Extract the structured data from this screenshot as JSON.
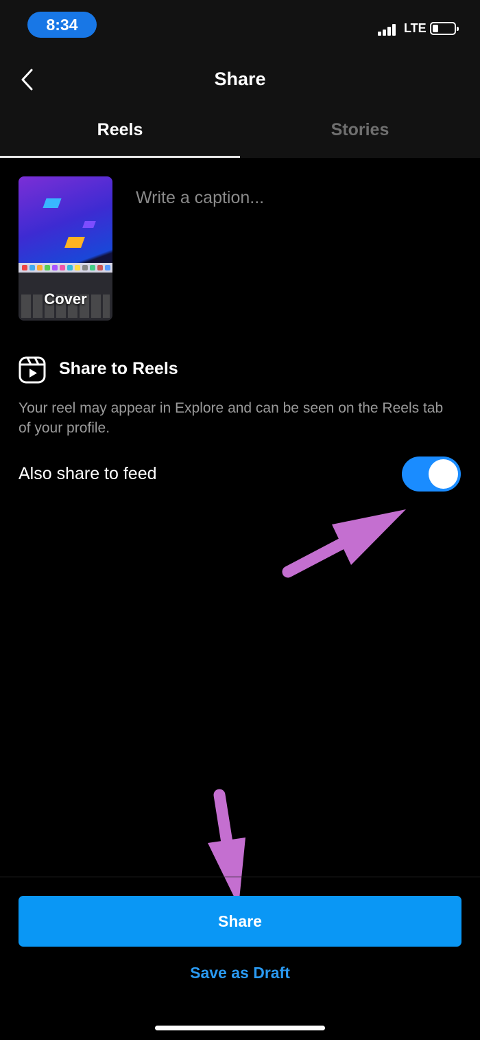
{
  "status_bar": {
    "time": "8:34",
    "network": "LTE"
  },
  "header": {
    "title": "Share",
    "back_icon": "chevron-left-icon"
  },
  "tabs": [
    {
      "label": "Reels",
      "active": true
    },
    {
      "label": "Stories",
      "active": false
    }
  ],
  "post": {
    "cover_label": "Cover",
    "caption_placeholder": "Write a caption...",
    "caption_value": ""
  },
  "share_to_reels": {
    "icon": "reels-icon",
    "title": "Share to Reels",
    "description": "Your reel may appear in Explore and can be seen on the Reels tab of your profile."
  },
  "feed_option": {
    "label": "Also share to feed",
    "enabled": true
  },
  "actions": {
    "share_label": "Share",
    "draft_label": "Save as Draft"
  },
  "colors": {
    "accent": "#0a97f5",
    "toggle_on": "#1a8cff",
    "link": "#2a9af2",
    "annotation_arrow": "#c46fd0",
    "time_pill": "#1877e6"
  }
}
